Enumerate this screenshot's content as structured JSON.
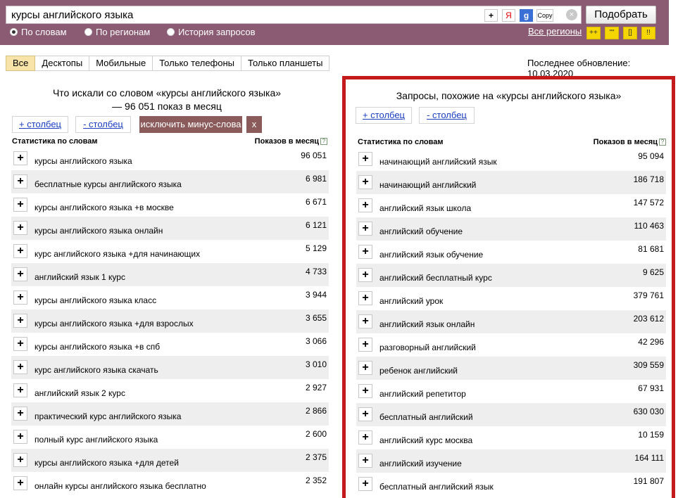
{
  "search": {
    "query": "курсы английского языка",
    "plus_label": "+",
    "ya_label": "Я",
    "g_label": "g",
    "copy_label": "Copy",
    "clear_label": "×",
    "submit_label": "Подобрать"
  },
  "modes": [
    {
      "label": "По словам",
      "checked": true
    },
    {
      "label": "По регионам",
      "checked": false
    },
    {
      "label": "История запросов",
      "checked": false
    }
  ],
  "regions_link": "Все регионы",
  "tools": [
    "++",
    "\"\"",
    "[]",
    "!!"
  ],
  "tabs": [
    {
      "label": "Все",
      "active": true
    },
    {
      "label": "Десктопы",
      "active": false
    },
    {
      "label": "Мобильные",
      "active": false
    },
    {
      "label": "Только телефоны",
      "active": false
    },
    {
      "label": "Только планшеты",
      "active": false
    }
  ],
  "last_update": "Последнее обновление: 10.03.2020",
  "left": {
    "title": "Что искали со словом «курсы английского языка» — 96 051 показ в месяц",
    "add_col": "+ столбец",
    "remove_col": "- столбец",
    "exclude": "исключить минус-слова",
    "x": "x",
    "col_phrase": "Статистика по словам",
    "col_count": "Показов в месяц",
    "help": "?",
    "rows": [
      {
        "phrase": "курсы английского языка",
        "count": "96 051"
      },
      {
        "phrase": "бесплатные курсы английского языка",
        "count": "6 981"
      },
      {
        "phrase": "курсы английского языка +в москве",
        "count": "6 671"
      },
      {
        "phrase": "курсы английского языка онлайн",
        "count": "6 121"
      },
      {
        "phrase": "курс английского языка +для начинающих",
        "count": "5 129"
      },
      {
        "phrase": "английский язык 1 курс",
        "count": "4 733"
      },
      {
        "phrase": "курсы английского языка класс",
        "count": "3 944"
      },
      {
        "phrase": "курсы английского языка +для взрослых",
        "count": "3 655"
      },
      {
        "phrase": "курсы английского языка +в спб",
        "count": "3 066"
      },
      {
        "phrase": "курс английского языка скачать",
        "count": "3 010"
      },
      {
        "phrase": "английский язык 2 курс",
        "count": "2 927"
      },
      {
        "phrase": "практический курс английского языка",
        "count": "2 866"
      },
      {
        "phrase": "полный курс английского языка",
        "count": "2 600"
      },
      {
        "phrase": "курсы английского языка +для детей",
        "count": "2 375"
      },
      {
        "phrase": "онлайн курсы английского языка бесплатно",
        "count": "2 352"
      }
    ]
  },
  "right": {
    "title": "Запросы, похожие на «курсы английского языка»",
    "add_col": "+ столбец",
    "remove_col": "- столбец",
    "col_phrase": "Статистика по словам",
    "col_count": "Показов в месяц",
    "help": "?",
    "rows": [
      {
        "phrase": "начинающий английский язык",
        "count": "95 094"
      },
      {
        "phrase": "начинающий английский",
        "count": "186 718"
      },
      {
        "phrase": "английский язык школа",
        "count": "147 572"
      },
      {
        "phrase": "английский обучение",
        "count": "110 463"
      },
      {
        "phrase": "английский язык обучение",
        "count": "81 681"
      },
      {
        "phrase": "английский бесплатный курс",
        "count": "9 625"
      },
      {
        "phrase": "английский урок",
        "count": "379 761"
      },
      {
        "phrase": "английский язык онлайн",
        "count": "203 612"
      },
      {
        "phrase": "разговорный английский",
        "count": "42 296"
      },
      {
        "phrase": "ребенок английский",
        "count": "309 559"
      },
      {
        "phrase": "английский репетитор",
        "count": "67 931"
      },
      {
        "phrase": "бесплатный английский",
        "count": "630 030"
      },
      {
        "phrase": "английский курс москва",
        "count": "10 159"
      },
      {
        "phrase": "английский изучение",
        "count": "164 111"
      },
      {
        "phrase": "бесплатный английский язык",
        "count": "191 807"
      }
    ]
  },
  "plus_label": "+"
}
